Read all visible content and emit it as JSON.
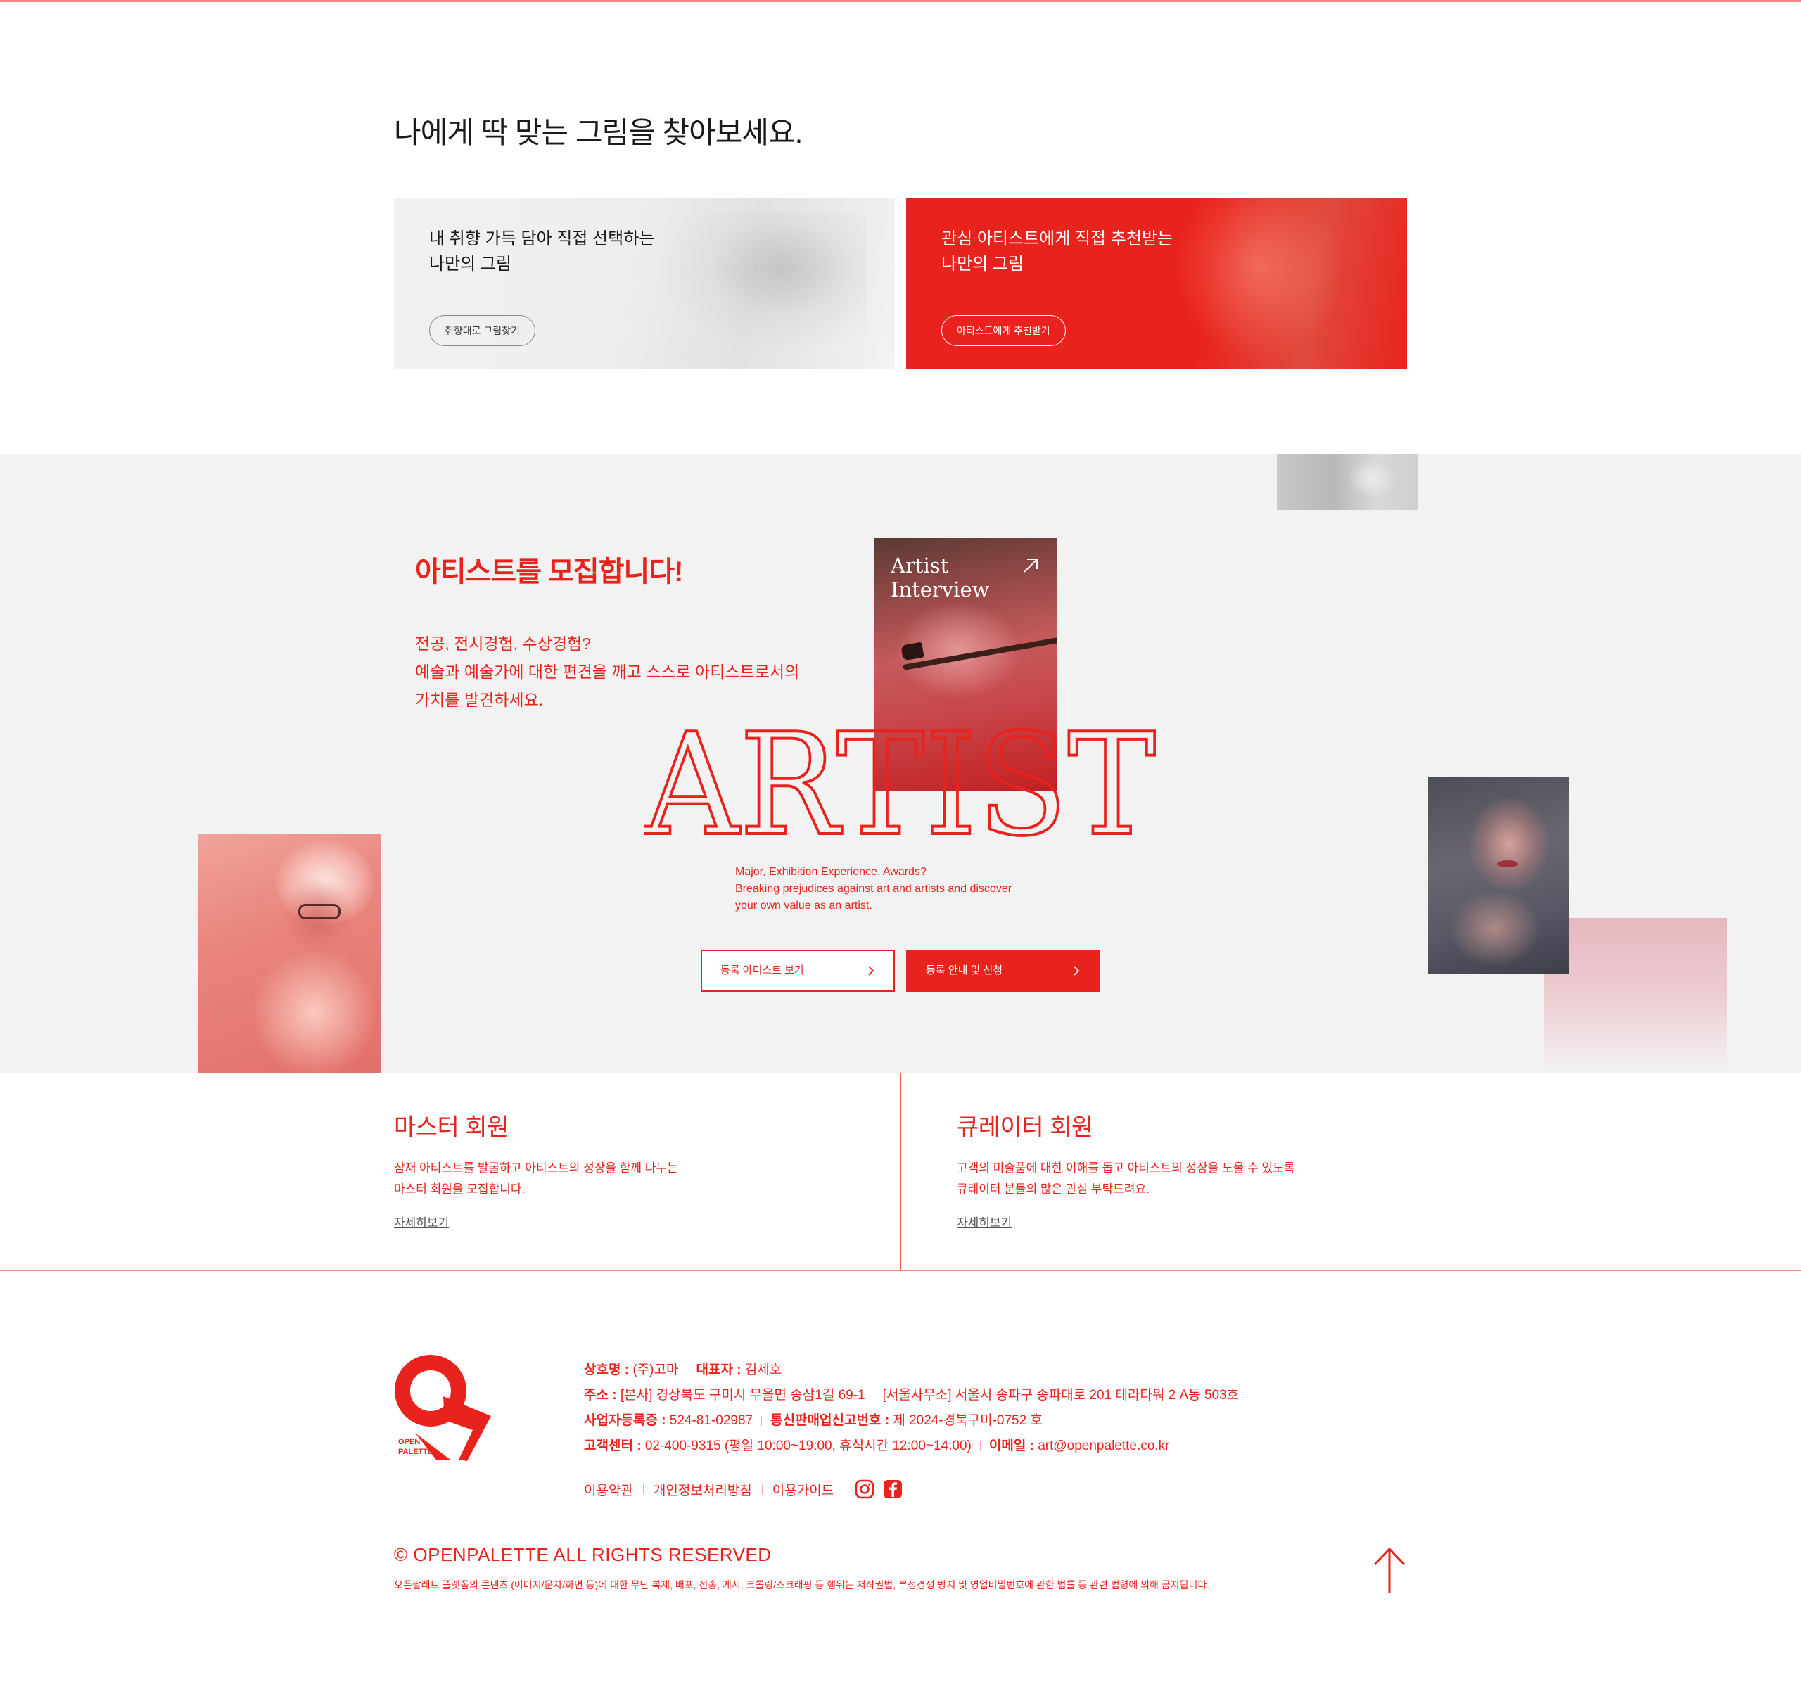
{
  "find": {
    "title": "나에게 딱 맞는 그림을 찾아보세요.",
    "cards": [
      {
        "line1": "내 취향 가득 담아 직접 선택하는",
        "line2": "나만의 그림",
        "button": "취향대로 그림찾기"
      },
      {
        "line1": "관심 아티스트에게 직접 추천받는",
        "line2": "나만의 그림",
        "button": "아티스트에게 추천받기"
      }
    ]
  },
  "recruit": {
    "title": "아티스트를 모집합니다!",
    "desc": [
      "전공, 전시경험, 수상경험?",
      "예술과 예술가에 대한 편견을 깨고 스스로 아티스트로서의",
      "가치를 발견하세요."
    ],
    "interview": {
      "line1": "Artist",
      "line2": "Interview"
    },
    "big_word": "ARTIST",
    "en_desc": [
      "Major, Exhibition Experience, Awards?",
      "Breaking prejudices against art and artists and discover",
      "your own value as an artist."
    ],
    "btn_outline": "등록 아티스트 보기",
    "btn_solid": "등록 안내 및 신청"
  },
  "members": [
    {
      "title": "마스터 회원",
      "desc1": "잠재 아티스트를 발굴하고 아티스트의 성장을 함께 나누는",
      "desc2": "마스터 회원을 모집합니다.",
      "link": "자세히보기"
    },
    {
      "title": "큐레이터 회원",
      "desc1": "고객의 미술품에 대한 이해를 돕고 아티스트의 성장을 도울 수 있도록",
      "desc2": "큐레이터 분들의 많은 관심 부탁드려요.",
      "link": "자세히보기"
    }
  ],
  "footer": {
    "logo_text": [
      "OPEN",
      "PALETTE"
    ],
    "company_label": "상호명 : ",
    "company": "(주)고마",
    "ceo_label": "대표자 : ",
    "ceo": "김세호",
    "address_label": "주소 : ",
    "address_hq": "[본사] 경상북도 구미시 무을면 송삼1길 69-1",
    "address_seoul": "[서울사무소] 서울시 송파구 송파대로 201 테라타워 2 A동 503호",
    "biz_label": "사업자등록증 : ",
    "biz": "524-81-02987",
    "ecommerce_label": "통신판매업신고번호 : ",
    "ecommerce": "제 2024-경북구미-0752 호",
    "cs_label": "고객센터 : ",
    "cs": "02-400-9315 (평일 10:00~19:00, 휴식시간 12:00~14:00)",
    "email_label": "이메일 : ",
    "email": "art@openpalette.co.kr",
    "links": [
      "이용약관",
      "개인정보처리방침",
      "이용가이드"
    ],
    "sns": [
      "instagram-icon",
      "facebook-icon"
    ],
    "copyright": "© OPENPALETTE ALL RIGHTS RESERVED",
    "disclaimer": "오픈팔레트 플랫폼의 콘텐츠 (이미지/문자/화면 등)에 대한 무단 복제, 배포, 전송, 게시, 크롤링/스크래핑 등 행위는 저작권법, 부정경쟁 방지 및 영업비밀번호에 관한 법률 등 관련 법령에 의해 금지됩니다."
  },
  "colors": {
    "accent": "#e8231d",
    "section_bg": "#f3f2f2",
    "line": "#f08a84"
  }
}
